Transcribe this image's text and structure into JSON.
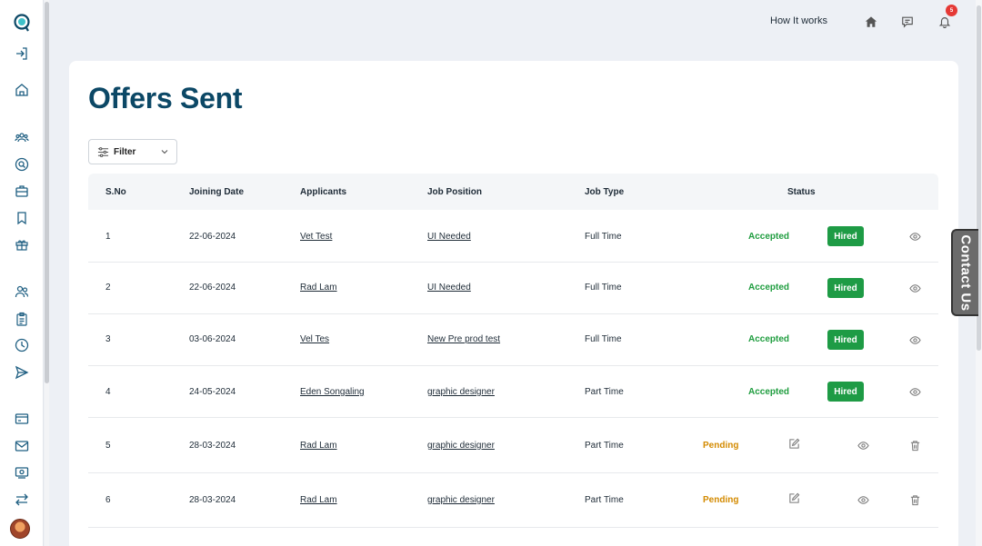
{
  "header": {
    "how_it_works": "How It works",
    "notification_count": "5",
    "icons": [
      "home-icon",
      "chat-icon",
      "bell-icon"
    ]
  },
  "sidebar": {
    "icons": [
      "logo",
      "logout-icon",
      "home-icon",
      "users-group-icon",
      "search-circle-icon",
      "briefcase-icon",
      "bookmark-icon",
      "gift-icon",
      "people-icon",
      "clipboard-icon",
      "clock-icon",
      "send-icon",
      "card-icon",
      "mail-icon",
      "payment-icon",
      "transfer-icon",
      "avatar"
    ]
  },
  "page": {
    "title": "Offers Sent",
    "filter_label": "Filter"
  },
  "table": {
    "headers": {
      "sno": "S.No",
      "joining_date": "Joining Date",
      "applicants": "Applicants",
      "job_position": "Job Position",
      "job_type": "Job Type",
      "status": "Status"
    },
    "rows": [
      {
        "sno": "1",
        "date": "22-06-2024",
        "applicant": "Vet Test",
        "position": "UI Needed",
        "type": "Full Time",
        "status": "Accepted",
        "tag": "Hired"
      },
      {
        "sno": "2",
        "date": "22-06-2024",
        "applicant": "Rad Lam",
        "position": "UI Needed",
        "type": "Full Time",
        "status": "Accepted",
        "tag": "Hired"
      },
      {
        "sno": "3",
        "date": "03-06-2024",
        "applicant": "Vel Tes",
        "position": "New Pre prod test",
        "type": "Full Time",
        "status": "Accepted",
        "tag": "Hired"
      },
      {
        "sno": "4",
        "date": "24-05-2024",
        "applicant": "Eden Songaling",
        "position": "graphic designer",
        "type": "Part Time",
        "status": "Accepted",
        "tag": "Hired"
      },
      {
        "sno": "5",
        "date": "28-03-2024",
        "applicant": "Rad Lam",
        "position": "graphic designer",
        "type": "Part Time",
        "status": "Pending",
        "tag": ""
      },
      {
        "sno": "6",
        "date": "28-03-2024",
        "applicant": "Rad Lam",
        "position": "graphic designer",
        "type": "Part Time",
        "status": "Pending",
        "tag": ""
      }
    ]
  },
  "contact_tab": "Contact Us",
  "colors": {
    "title": "#0c4866",
    "accepted": "#1f9d3f",
    "pending": "#d38a00",
    "hired_bg": "#1e9b45",
    "badge": "#e53935"
  }
}
